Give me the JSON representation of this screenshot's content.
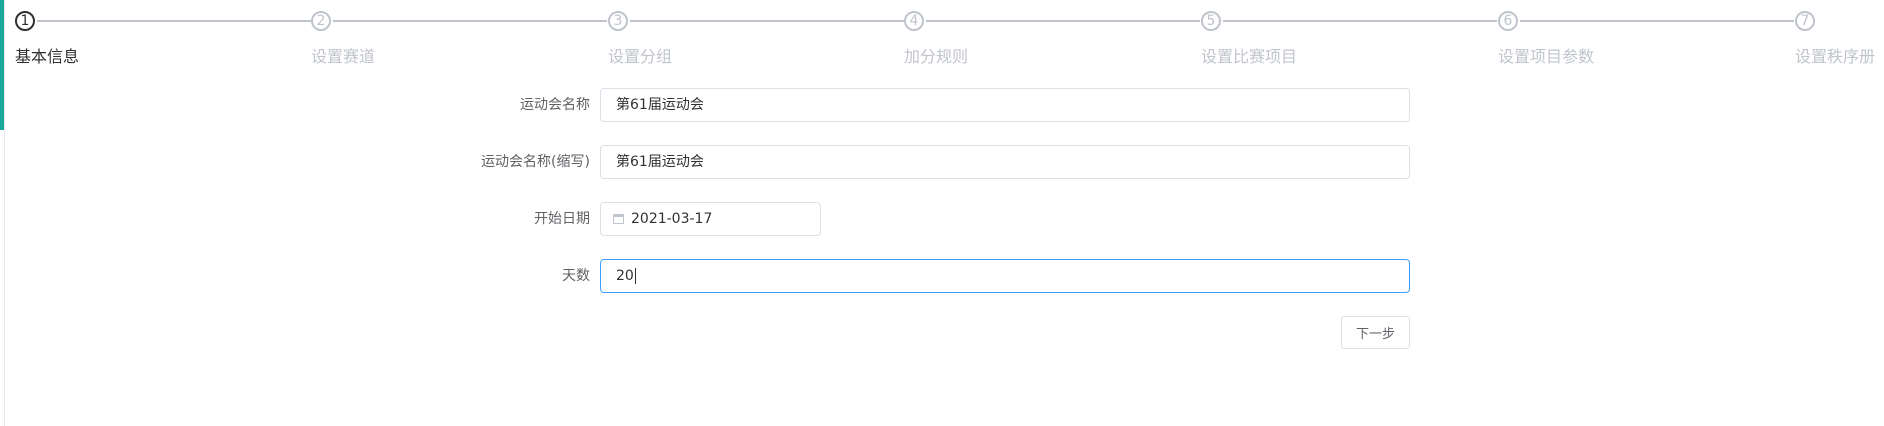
{
  "steps": [
    {
      "number": "1",
      "title": "基本信息",
      "active": true
    },
    {
      "number": "2",
      "title": "设置赛道",
      "active": false
    },
    {
      "number": "3",
      "title": "设置分组",
      "active": false
    },
    {
      "number": "4",
      "title": "加分规则",
      "active": false
    },
    {
      "number": "5",
      "title": "设置比赛项目",
      "active": false
    },
    {
      "number": "6",
      "title": "设置项目参数",
      "active": false
    },
    {
      "number": "7",
      "title": "设置秩序册",
      "active": false
    }
  ],
  "form": {
    "meet_name": {
      "label": "运动会名称",
      "value": "第61届运动会"
    },
    "meet_short_name": {
      "label": "运动会名称(缩写)",
      "value": "第61届运动会"
    },
    "start_date": {
      "label": "开始日期",
      "value": "2021-03-17"
    },
    "days": {
      "label": "天数",
      "value": "20"
    }
  },
  "next_button": {
    "label": "下一步"
  },
  "colors": {
    "accent": "#1aa79a",
    "focus": "#409eff",
    "inactive": "#c0c4cc",
    "active": "#303133"
  }
}
